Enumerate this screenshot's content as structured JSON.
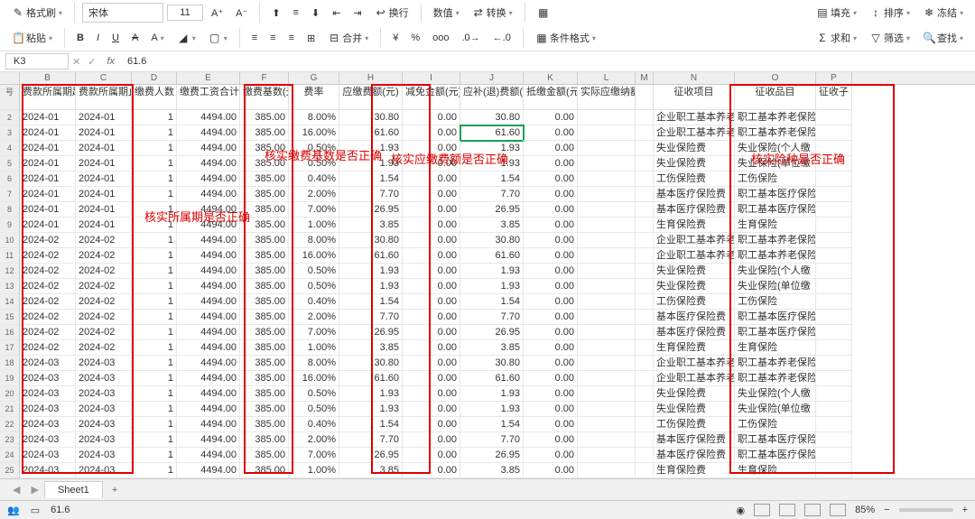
{
  "toolbar": {
    "format_brush": "格式刷",
    "paste": "粘贴",
    "font_name": "宋体",
    "font_size": "11",
    "wrap": "换行",
    "number_format": "数值",
    "convert": "转换",
    "cond_format": "条件格式",
    "fill": "填充",
    "sort": "排序",
    "freeze": "冻结",
    "sum": "求和",
    "filter": "筛选",
    "find": "查找",
    "merge": "合并"
  },
  "namebox": {
    "cell": "K3",
    "formula": "61.6"
  },
  "annotations": {
    "a1": "核实缴费基数是否正确",
    "a2": "核实应缴费额是否正确",
    "a3": "核实险种是否正确",
    "a4": "核实所属期是否正确"
  },
  "columns": {
    "letters": [
      "B",
      "C",
      "D",
      "E",
      "F",
      "G",
      "H",
      "I",
      "J",
      "K",
      "L",
      "M",
      "N",
      "O",
      "P"
    ],
    "widths": [
      22,
      62,
      62,
      50,
      70,
      54,
      56,
      70,
      64,
      70,
      60,
      64,
      20,
      90,
      90,
      40
    ]
  },
  "headers": {
    "c1": "号",
    "c2": "费款所属期起",
    "c3": "费款所属期止",
    "c4": "缴费人数",
    "c5": "缴费工资合计",
    "c6": "缴费基数(元)",
    "c7": "费率",
    "c8": "应缴费额(元)",
    "c9": "减免金额(元)",
    "c10": "应补(退)费额(元)",
    "c11": "抵缴金额(元)",
    "c12": "实际应缴纳额(元)",
    "c13": "",
    "c14": "征收项目",
    "c15": "征收品目",
    "c16": "征收子"
  },
  "chart_data": {
    "type": "table",
    "columns": [
      "费款所属期起",
      "费款所属期止",
      "缴费人数",
      "缴费工资合计",
      "缴费基数(元)",
      "费率",
      "应缴费额(元)",
      "减免金额(元)",
      "应补(退)费额(元)",
      "抵缴金额(元)",
      "征收项目",
      "征收品目"
    ],
    "rows": [
      [
        "2024-01",
        "2024-01",
        1,
        "4494.00",
        "385.00",
        "8.00%",
        "30.80",
        "0.00",
        "30.80",
        "0.00",
        "企业职工基本养老",
        "职工基本养老保险"
      ],
      [
        "2024-01",
        "2024-01",
        1,
        "4494.00",
        "385.00",
        "16.00%",
        "61.60",
        "0.00",
        "61.60",
        "0.00",
        "企业职工基本养老",
        "职工基本养老保险"
      ],
      [
        "2024-01",
        "2024-01",
        1,
        "4494.00",
        "385.00",
        "0.50%",
        "1.93",
        "0.00",
        "1.93",
        "0.00",
        "失业保险费",
        "失业保险(个人缴"
      ],
      [
        "2024-01",
        "2024-01",
        1,
        "4494.00",
        "385.00",
        "0.50%",
        "1.93",
        "0.00",
        "1.93",
        "0.00",
        "失业保险费",
        "失业保险(单位缴"
      ],
      [
        "2024-01",
        "2024-01",
        1,
        "4494.00",
        "385.00",
        "0.40%",
        "1.54",
        "0.00",
        "1.54",
        "0.00",
        "工伤保险费",
        "工伤保险"
      ],
      [
        "2024-01",
        "2024-01",
        1,
        "4494.00",
        "385.00",
        "2.00%",
        "7.70",
        "0.00",
        "7.70",
        "0.00",
        "基本医疗保险费",
        "职工基本医疗保险"
      ],
      [
        "2024-01",
        "2024-01",
        1,
        "4494.00",
        "385.00",
        "7.00%",
        "26.95",
        "0.00",
        "26.95",
        "0.00",
        "基本医疗保险费",
        "职工基本医疗保险"
      ],
      [
        "2024-01",
        "2024-01",
        1,
        "4494.00",
        "385.00",
        "1.00%",
        "3.85",
        "0.00",
        "3.85",
        "0.00",
        "生育保险费",
        "生育保险"
      ],
      [
        "2024-02",
        "2024-02",
        1,
        "4494.00",
        "385.00",
        "8.00%",
        "30.80",
        "0.00",
        "30.80",
        "0.00",
        "企业职工基本养老",
        "职工基本养老保险"
      ],
      [
        "2024-02",
        "2024-02",
        1,
        "4494.00",
        "385.00",
        "16.00%",
        "61.60",
        "0.00",
        "61.60",
        "0.00",
        "企业职工基本养老",
        "职工基本养老保险"
      ],
      [
        "2024-02",
        "2024-02",
        1,
        "4494.00",
        "385.00",
        "0.50%",
        "1.93",
        "0.00",
        "1.93",
        "0.00",
        "失业保险费",
        "失业保险(个人缴"
      ],
      [
        "2024-02",
        "2024-02",
        1,
        "4494.00",
        "385.00",
        "0.50%",
        "1.93",
        "0.00",
        "1.93",
        "0.00",
        "失业保险费",
        "失业保险(单位缴"
      ],
      [
        "2024-02",
        "2024-02",
        1,
        "4494.00",
        "385.00",
        "0.40%",
        "1.54",
        "0.00",
        "1.54",
        "0.00",
        "工伤保险费",
        "工伤保险"
      ],
      [
        "2024-02",
        "2024-02",
        1,
        "4494.00",
        "385.00",
        "2.00%",
        "7.70",
        "0.00",
        "7.70",
        "0.00",
        "基本医疗保险费",
        "职工基本医疗保险"
      ],
      [
        "2024-02",
        "2024-02",
        1,
        "4494.00",
        "385.00",
        "7.00%",
        "26.95",
        "0.00",
        "26.95",
        "0.00",
        "基本医疗保险费",
        "职工基本医疗保险"
      ],
      [
        "2024-02",
        "2024-02",
        1,
        "4494.00",
        "385.00",
        "1.00%",
        "3.85",
        "0.00",
        "3.85",
        "0.00",
        "生育保险费",
        "生育保险"
      ],
      [
        "2024-03",
        "2024-03",
        1,
        "4494.00",
        "385.00",
        "8.00%",
        "30.80",
        "0.00",
        "30.80",
        "0.00",
        "企业职工基本养老",
        "职工基本养老保险"
      ],
      [
        "2024-03",
        "2024-03",
        1,
        "4494.00",
        "385.00",
        "16.00%",
        "61.60",
        "0.00",
        "61.60",
        "0.00",
        "企业职工基本养老",
        "职工基本养老保险"
      ],
      [
        "2024-03",
        "2024-03",
        1,
        "4494.00",
        "385.00",
        "0.50%",
        "1.93",
        "0.00",
        "1.93",
        "0.00",
        "失业保险费",
        "失业保险(个人缴"
      ],
      [
        "2024-03",
        "2024-03",
        1,
        "4494.00",
        "385.00",
        "0.50%",
        "1.93",
        "0.00",
        "1.93",
        "0.00",
        "失业保险费",
        "失业保险(单位缴"
      ],
      [
        "2024-03",
        "2024-03",
        1,
        "4494.00",
        "385.00",
        "0.40%",
        "1.54",
        "0.00",
        "1.54",
        "0.00",
        "工伤保险费",
        "工伤保险"
      ],
      [
        "2024-03",
        "2024-03",
        1,
        "4494.00",
        "385.00",
        "2.00%",
        "7.70",
        "0.00",
        "7.70",
        "0.00",
        "基本医疗保险费",
        "职工基本医疗保险"
      ],
      [
        "2024-03",
        "2024-03",
        1,
        "4494.00",
        "385.00",
        "7.00%",
        "26.95",
        "0.00",
        "26.95",
        "0.00",
        "基本医疗保险费",
        "职工基本医疗保险"
      ],
      [
        "2024-03",
        "2024-03",
        1,
        "4494.00",
        "385.00",
        "1.00%",
        "3.85",
        "0.00",
        "3.85",
        "0.00",
        "生育保险费",
        "生育保险"
      ]
    ]
  },
  "row_start": 2,
  "sheet_tab": "Sheet1",
  "status": {
    "left_val": "61.6",
    "zoom": "85%"
  }
}
